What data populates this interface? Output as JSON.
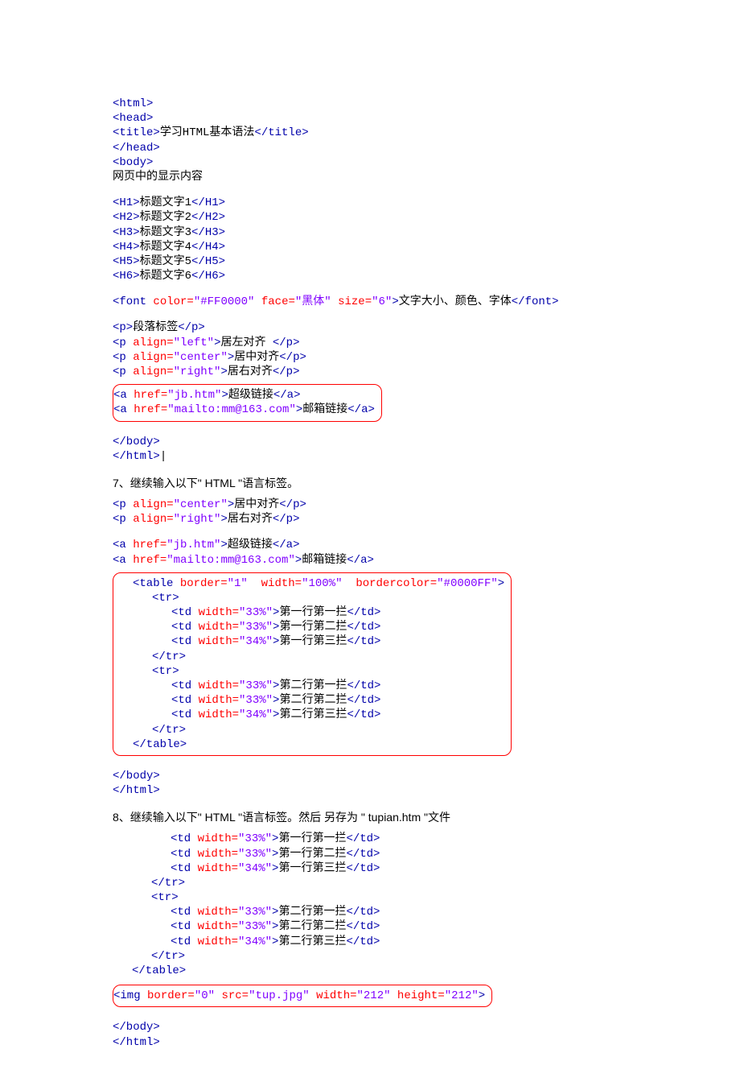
{
  "block1": {
    "l1": {
      "tag_o": "<html>"
    },
    "l2": {
      "tag_o": "<head>"
    },
    "l3": {
      "tag_o": "<title>",
      "txt": "学习HTML基本语法",
      "tag_c": "</title>"
    },
    "l4": {
      "tag_o": "</head>"
    },
    "l5": {
      "tag_o": "<body>"
    },
    "l6": {
      "txt": "网页中的显示内容"
    },
    "h1": {
      "o": "<H1>",
      "t": "标题文字1",
      "c": "</H1>"
    },
    "h2": {
      "o": "<H2>",
      "t": "标题文字2",
      "c": "</H2>"
    },
    "h3": {
      "o": "<H3>",
      "t": "标题文字3",
      "c": "</H3>"
    },
    "h4": {
      "o": "<H4>",
      "t": "标题文字4",
      "c": "</H4>"
    },
    "h5": {
      "o": "<H5>",
      "t": "标题文字5",
      "c": "</H5>"
    },
    "h6": {
      "o": "<H6>",
      "t": "标题文字6",
      "c": "</H6>"
    },
    "font": {
      "o": "<font ",
      "a1": "color=",
      "v1": "\"#FF0000\"",
      "a2": " face=",
      "v2": "\"黑体\"",
      "a3": " size=",
      "v3": "\"6\"",
      "c1": ">",
      "t": "文字大小、颜色、字体",
      "c": "</font>"
    },
    "p1": {
      "o": "<p>",
      "t": "段落标签",
      "c": "</p>"
    },
    "p2": {
      "o": "<p ",
      "a": "align=",
      "v": "\"left\"",
      "c1": ">",
      "t": "居左对齐 ",
      "c": "</p>"
    },
    "p3": {
      "o": "<p ",
      "a": "align=",
      "v": "\"center\"",
      "c1": ">",
      "t": "居中对齐",
      "c": "</p>"
    },
    "p4": {
      "o": "<p ",
      "a": "align=",
      "v": "\"right\"",
      "c1": ">",
      "t": "居右对齐",
      "c": "</p>"
    },
    "a1": {
      "o": "<a ",
      "a": "href=",
      "v": "\"jb.htm\"",
      "c1": ">",
      "t": "超级链接",
      "c": "</a>"
    },
    "a2": {
      "o": "<a ",
      "a": "href=",
      "v": "\"mailto:mm@163.com\"",
      "c1": ">",
      "t": "邮箱链接",
      "c": "</a>"
    },
    "end1": {
      "t": "</body>"
    },
    "end2": {
      "t": "</html>"
    },
    "cursor": "|"
  },
  "step7": "7、继续输入以下\" HTML \"语言标签。",
  "block2": {
    "p3": {
      "o": "<p ",
      "a": "align=",
      "v": "\"center\"",
      "c1": ">",
      "t": "居中对齐",
      "c": "</p>"
    },
    "p4": {
      "o": "<p ",
      "a": "align=",
      "v": "\"right\"",
      "c1": ">",
      "t": "居右对齐",
      "c": "</p>"
    },
    "a1": {
      "o": "<a ",
      "a": "href=",
      "v": "\"jb.htm\"",
      "c1": ">",
      "t": "超级链接",
      "c": "</a>"
    },
    "a2": {
      "o": "<a ",
      "a": "href=",
      "v": "\"mailto:mm@163.com\"",
      "c1": ">",
      "t": "邮箱链接",
      "c": "</a>"
    },
    "tbl": {
      "o": "<table ",
      "a1": "border=",
      "v1": "\"1\"",
      "sp": "  ",
      "a2": "width=",
      "v2": "\"100%\"",
      "sp2": "  ",
      "a3": "bordercolor=",
      "v3": "\"#0000FF\"",
      "c1": ">"
    },
    "tr": "<tr>",
    "trc": "</tr>",
    "r1c1": {
      "o": "<td ",
      "a": "width=",
      "v": "\"33%\"",
      "c1": ">",
      "t": "第一行第一拦",
      "c": "</td>"
    },
    "r1c2": {
      "o": "<td ",
      "a": "width=",
      "v": "\"33%\"",
      "c1": ">",
      "t": "第一行第二拦",
      "c": "</td>"
    },
    "r1c3": {
      "o": "<td ",
      "a": "width=",
      "v": "\"34%\"",
      "c1": ">",
      "t": "第一行第三拦",
      "c": "</td>"
    },
    "r2c1": {
      "o": "<td ",
      "a": "width=",
      "v": "\"33%\"",
      "c1": ">",
      "t": "第二行第一拦",
      "c": "</td>"
    },
    "r2c2": {
      "o": "<td ",
      "a": "width=",
      "v": "\"33%\"",
      "c1": ">",
      "t": "第二行第二拦",
      "c": "</td>"
    },
    "r2c3": {
      "o": "<td ",
      "a": "width=",
      "v": "\"34%\"",
      "c1": ">",
      "t": "第二行第三拦",
      "c": "</td>"
    },
    "tblc": "</table>",
    "end1": "</body>",
    "end2": "</html>"
  },
  "step8": "8、继续输入以下\" HTML \"语言标签。然后  另存为 \" tupian.htm \"文件",
  "block3": {
    "r1c1": {
      "o": "<td ",
      "a": "width=",
      "v": "\"33%\"",
      "c1": ">",
      "t": "第一行第一拦",
      "c": "</td>"
    },
    "r1c2": {
      "o": "<td ",
      "a": "width=",
      "v": "\"33%\"",
      "c1": ">",
      "t": "第一行第二拦",
      "c": "</td>"
    },
    "r1c3": {
      "o": "<td ",
      "a": "width=",
      "v": "\"34%\"",
      "c1": ">",
      "t": "第一行第三拦",
      "c": "</td>"
    },
    "tr": "<tr>",
    "trc": "</tr>",
    "r2c1": {
      "o": "<td ",
      "a": "width=",
      "v": "\"33%\"",
      "c1": ">",
      "t": "第二行第一拦",
      "c": "</td>"
    },
    "r2c2": {
      "o": "<td ",
      "a": "width=",
      "v": "\"33%\"",
      "c1": ">",
      "t": "第二行第二拦",
      "c": "</td>"
    },
    "r2c3": {
      "o": "<td ",
      "a": "width=",
      "v": "\"34%\"",
      "c1": ">",
      "t": "第二行第三拦",
      "c": "</td>"
    },
    "tblc": "</table>",
    "img": {
      "o": "<img ",
      "a1": "border=",
      "v1": "\"0\"",
      "a2": " src=",
      "v2": "\"tup.jpg\"",
      "a3": " width=",
      "v3": "\"212\"",
      "a4": " height=",
      "v4": "\"212\"",
      "c1": ">"
    },
    "end1": "</body>",
    "end2": "</html>"
  }
}
